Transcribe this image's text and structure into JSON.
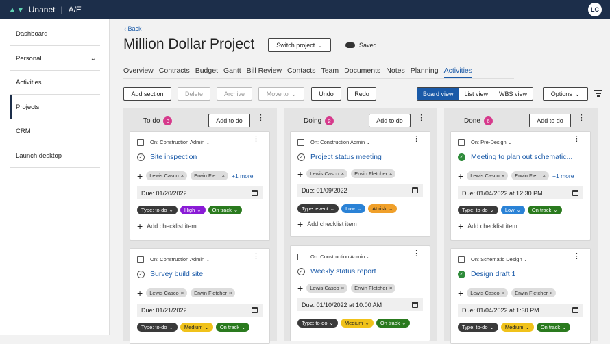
{
  "app": {
    "brand": "Unanet",
    "product": "A/E",
    "user_initials": "LC"
  },
  "sidebar": {
    "items": [
      {
        "label": "Dashboard"
      },
      {
        "label": "Personal"
      },
      {
        "label": "Activities"
      },
      {
        "label": "Projects"
      },
      {
        "label": "CRM"
      },
      {
        "label": "Launch desktop"
      }
    ]
  },
  "header": {
    "back": "Back",
    "title": "Million Dollar Project",
    "switch_label": "Switch project",
    "saved": "Saved"
  },
  "tabs": [
    "Overview",
    "Contracts",
    "Budget",
    "Gantt",
    "Bill Review",
    "Contacts",
    "Team",
    "Documents",
    "Notes",
    "Planning",
    "Activities"
  ],
  "toolbar": {
    "add_section": "Add section",
    "delete": "Delete",
    "archive": "Archive",
    "move_to": "Move to",
    "undo": "Undo",
    "redo": "Redo",
    "views": [
      "Board view",
      "List view",
      "WBS view"
    ],
    "options": "Options"
  },
  "columns": [
    {
      "name": "To do",
      "count": "3",
      "add": "Add to do",
      "cards": [
        {
          "on": "On: Construction Admin",
          "title": "Site inspection",
          "people": [
            "Lewis Casco",
            "Erwin Fle..."
          ],
          "more": "+1 more",
          "due": "Due: 01/20/2022",
          "type": "Type: to-do",
          "priority": "High",
          "status": "On track",
          "checklist": "Add checklist item"
        },
        {
          "on": "On: Construction Admin",
          "title": "Survey build site",
          "people": [
            "Lewis Casco",
            "Erwin Fletcher"
          ],
          "more": "",
          "due": "Due: 01/21/2022",
          "type": "Type: to-do",
          "priority": "Medium",
          "status": "On track",
          "checklist": ""
        }
      ]
    },
    {
      "name": "Doing",
      "count": "2",
      "add": "Add to do",
      "cards": [
        {
          "on": "On: Construction Admin",
          "title": "Project status meeting",
          "people": [
            "Lewis Casco",
            "Erwin Fletcher"
          ],
          "more": "",
          "due": "Due: 01/09/2022",
          "type": "Type: event",
          "priority": "Low",
          "status": "At risk",
          "checklist": "Add checklist item"
        },
        {
          "on": "On: Construction Admin",
          "title": "Weekly status report",
          "people": [
            "Lewis Casco",
            "Erwin Fletcher"
          ],
          "more": "",
          "due": "Due: 01/10/2022 at 10:00 AM",
          "type": "Type: to-do",
          "priority": "Medium",
          "status": "On track",
          "checklist": ""
        }
      ]
    },
    {
      "name": "Done",
      "count": "6",
      "add": "Add to do",
      "cards": [
        {
          "on": "On: Pre-Design",
          "title": "Meeting to plan out schematic...",
          "people": [
            "Lewis Casco",
            "Erwin Fle..."
          ],
          "more": "+1 more",
          "due": "Due: 01/04/2022 at 12:30 PM",
          "type": "Type: to-do",
          "priority": "Low",
          "status": "On track",
          "checklist": "Add checklist item"
        },
        {
          "on": "On: Schematic Design",
          "title": "Design draft 1",
          "people": [
            "Lewis Casco",
            "Erwin Fletcher"
          ],
          "more": "",
          "due": "Due: 01/04/2022 at 1:30 PM",
          "type": "Type: to-do",
          "priority": "Medium",
          "status": "On track",
          "checklist": ""
        }
      ]
    }
  ]
}
